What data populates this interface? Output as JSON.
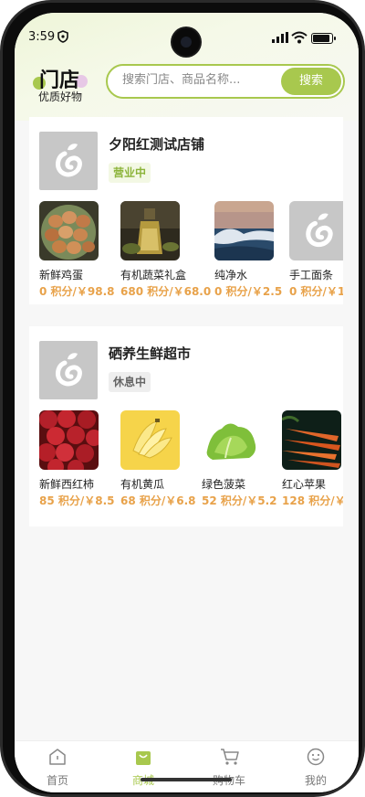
{
  "status_bar": {
    "time": "3:59"
  },
  "header": {
    "logo_title": "门店",
    "logo_subtitle": "优质好物",
    "search_placeholder": "搜索门店、商品名称...",
    "search_button": "搜索"
  },
  "stores": [
    {
      "name": "夕阳红测试店铺",
      "status": "营业中",
      "products": [
        {
          "name": "新鲜鸡蛋",
          "price": "0 积分/￥98.8",
          "image": "eggs-photo"
        },
        {
          "name": "有机蔬菜礼盒",
          "price": "680 积分/￥68.0",
          "image": "oil-bottle-photo"
        },
        {
          "name": "纯净水",
          "price": "0 积分/￥2.5",
          "image": "ocean-wave-photo"
        },
        {
          "name": "手工面条",
          "price": "0 积分/￥1",
          "image": "placeholder-logo"
        }
      ]
    },
    {
      "name": "硒养生鲜超市",
      "status": "休息中",
      "products": [
        {
          "name": "新鲜西红柿",
          "price": "85 积分/￥8.5",
          "image": "red-apples-photo"
        },
        {
          "name": "有机黄瓜",
          "price": "68 积分/￥6.8",
          "image": "bananas-photo"
        },
        {
          "name": "绿色菠菜",
          "price": "52 积分/￥5.2",
          "image": "lettuce-photo"
        },
        {
          "name": "红心苹果",
          "price": "128 积分/￥",
          "image": "carrots-photo"
        }
      ]
    }
  ],
  "tabbar": {
    "items": [
      {
        "label": "首页",
        "icon": "home-icon"
      },
      {
        "label": "商城",
        "icon": "shopping-bag-icon",
        "active": true
      },
      {
        "label": "购物车",
        "icon": "cart-icon"
      },
      {
        "label": "我的",
        "icon": "profile-icon"
      }
    ]
  },
  "colors": {
    "accent": "#a8c84e",
    "price": "#e8a24a",
    "open_badge_text": "#8cb43a"
  }
}
